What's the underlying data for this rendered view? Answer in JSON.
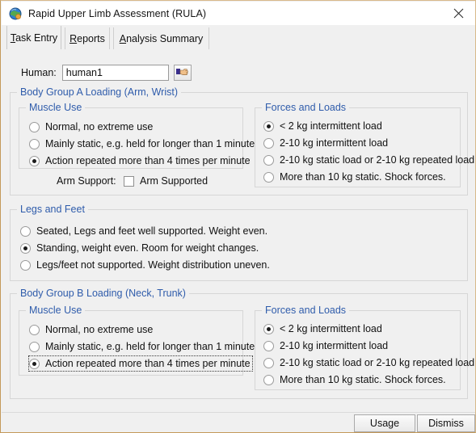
{
  "window": {
    "title": "Rapid Upper Limb Assessment (RULA)",
    "app_icon": "globe-icon",
    "close_label": "✕",
    "border_color": "#d8b98a",
    "background_color": "#f0f0f0",
    "group_title_color": "#2f5cab"
  },
  "tabs": [
    {
      "label": "Task Entry",
      "mnemonic": "T",
      "selected": true
    },
    {
      "label": "Reports",
      "mnemonic": "R",
      "selected": false
    },
    {
      "label": "Analysis Summary",
      "mnemonic": "A",
      "selected": false
    }
  ],
  "human": {
    "label": "Human:",
    "value": "human1",
    "placeholder": "",
    "pick_icon": "pointing-hand-icon"
  },
  "group_a": {
    "title": "Body Group A Loading (Arm, Wrist)",
    "muscle_use": {
      "title": "Muscle Use",
      "options": [
        {
          "label": "Normal, no extreme use",
          "checked": false,
          "focused": false
        },
        {
          "label": "Mainly static, e.g. held for longer than 1 minute",
          "checked": false,
          "focused": false
        },
        {
          "label": "Action repeated more than 4 times per minute",
          "checked": true,
          "focused": false
        }
      ]
    },
    "arm_support": {
      "label": "Arm Support:",
      "checkbox_label": "Arm Supported",
      "checked": false
    },
    "forces_and_loads": {
      "title": "Forces and Loads",
      "options": [
        {
          "label": "< 2 kg intermittent load",
          "checked": true,
          "focused": false
        },
        {
          "label": "2-10 kg intermittent load",
          "checked": false,
          "focused": false
        },
        {
          "label": "2-10 kg static load or 2-10 kg repeated load",
          "checked": false,
          "focused": false
        },
        {
          "label": "More than 10 kg static.  Shock forces.",
          "checked": false,
          "focused": false
        }
      ]
    }
  },
  "legs_and_feet": {
    "title": "Legs and Feet",
    "options": [
      {
        "label": "Seated, Legs and feet well supported.  Weight even.",
        "checked": false,
        "focused": false
      },
      {
        "label": "Standing, weight even.  Room for weight changes.",
        "checked": true,
        "focused": false
      },
      {
        "label": "Legs/feet not supported.  Weight distribution uneven.",
        "checked": false,
        "focused": false
      }
    ]
  },
  "group_b": {
    "title": "Body Group B Loading (Neck, Trunk)",
    "muscle_use": {
      "title": "Muscle Use",
      "options": [
        {
          "label": "Normal, no extreme use",
          "checked": false,
          "focused": false
        },
        {
          "label": "Mainly static, e.g. held for longer than 1 minute",
          "checked": false,
          "focused": false
        },
        {
          "label": "Action repeated more than 4 times per minute",
          "checked": true,
          "focused": true
        }
      ]
    },
    "forces_and_loads": {
      "title": "Forces and Loads",
      "options": [
        {
          "label": "< 2 kg intermittent load",
          "checked": true,
          "focused": false
        },
        {
          "label": "2-10 kg intermittent load",
          "checked": false,
          "focused": false
        },
        {
          "label": "2-10 kg static load or 2-10 kg repeated load",
          "checked": false,
          "focused": false
        },
        {
          "label": "More than 10 kg static.  Shock forces.",
          "checked": false,
          "focused": false
        }
      ]
    }
  },
  "buttons": {
    "usage": "Usage",
    "dismiss": "Dismiss"
  }
}
